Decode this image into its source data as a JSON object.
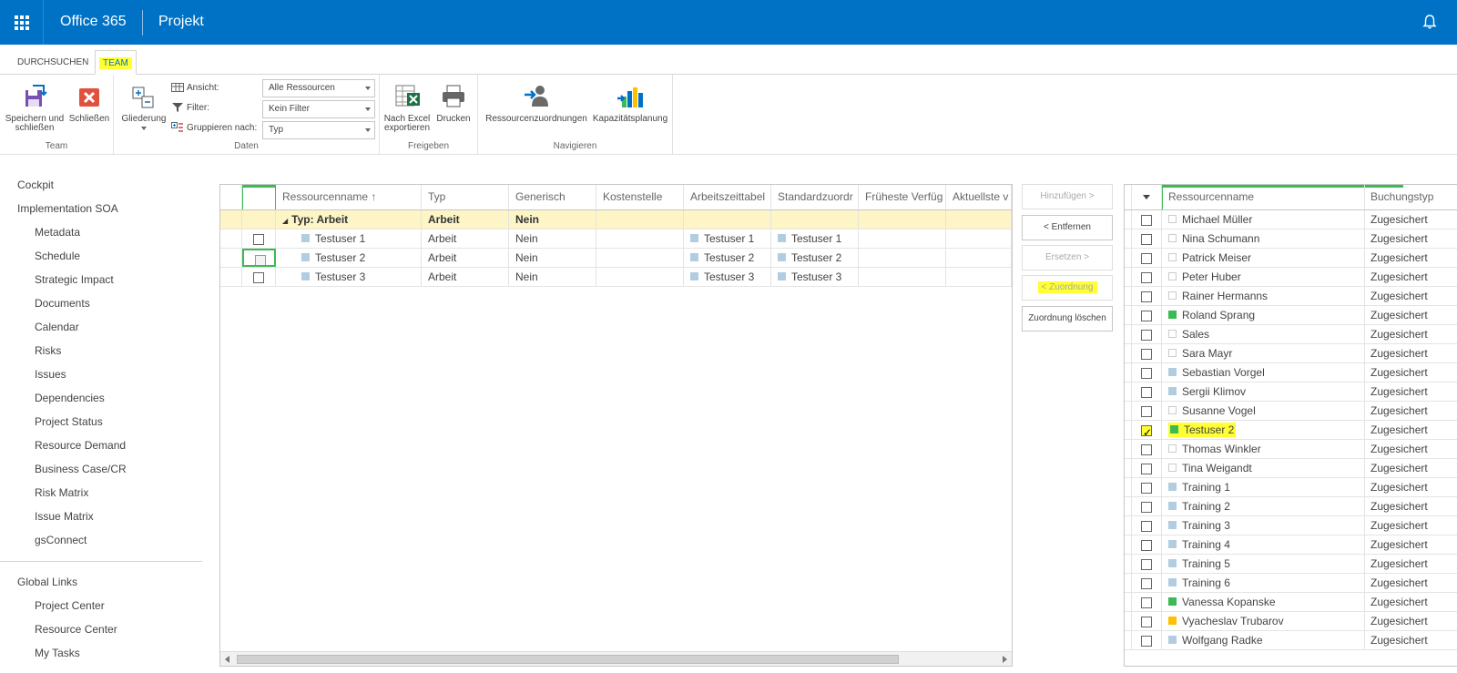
{
  "suitebar": {
    "brand": "Office 365",
    "app": "Projekt"
  },
  "ribbon_tabs": [
    {
      "label": "DURCHSUCHEN"
    },
    {
      "label": "TEAM"
    }
  ],
  "ribbon": {
    "team_group": {
      "label": "Team",
      "save": "Speichern und schließen",
      "close": "Schließen"
    },
    "daten_group": {
      "label": "Daten",
      "outline": "Gliederung",
      "view_label": "Ansicht:",
      "view_value": "Alle Ressourcen",
      "filter_label": "Filter:",
      "filter_value": "Kein Filter",
      "group_label": "Gruppieren nach:",
      "group_value": "Typ"
    },
    "freigeben_group": {
      "label": "Freigeben",
      "export": "Nach Excel exportieren",
      "print": "Drucken"
    },
    "navigieren_group": {
      "label": "Navigieren",
      "assignments": "Ressourcenzuordnungen",
      "capacity": "Kapazitätsplanung"
    }
  },
  "leftnav": {
    "items": [
      "Cockpit",
      "Implementation SOA",
      "Metadata",
      "Schedule",
      "Strategic Impact",
      "Documents",
      "Calendar",
      "Risks",
      "Issues",
      "Dependencies",
      "Project Status",
      "Resource Demand",
      "Business Case/CR",
      "Risk Matrix",
      "Issue Matrix",
      "gsConnect"
    ],
    "global_title": "Global Links",
    "global_items": [
      "Project Center",
      "Resource Center",
      "My Tasks"
    ]
  },
  "maingrid": {
    "headers": [
      "Ressourcenname ↑",
      "Typ",
      "Generisch",
      "Kostenstelle",
      "Arbeitszeittabel",
      "Standardzuordr",
      "Früheste Verfüg",
      "Aktuellste v"
    ],
    "group_row": {
      "name": "Typ: Arbeit",
      "type": "Arbeit",
      "generic": "Nein"
    },
    "rows": [
      {
        "name": "Testuser 1",
        "type": "Arbeit",
        "generic": "Nein",
        "timesheet": "Testuser 1",
        "default": "Testuser 1"
      },
      {
        "name": "Testuser 2",
        "type": "Arbeit",
        "generic": "Nein",
        "timesheet": "Testuser 2",
        "default": "Testuser 2"
      },
      {
        "name": "Testuser 3",
        "type": "Arbeit",
        "generic": "Nein",
        "timesheet": "Testuser 3",
        "default": "Testuser 3"
      }
    ]
  },
  "middle_buttons": {
    "add": "Hinzufügen >",
    "remove": "< Entfernen",
    "replace": "Ersetzen >",
    "assign": "< Zuordnung",
    "clear": "Zuordnung löschen"
  },
  "rightgrid": {
    "headers": [
      "Ressourcenname",
      "Buchungstyp"
    ],
    "rows": [
      {
        "name": "Michael Müller",
        "booking": "Zugesichert",
        "sq": "empty",
        "checked": false
      },
      {
        "name": "Nina Schumann",
        "booking": "Zugesichert",
        "sq": "empty",
        "checked": false
      },
      {
        "name": "Patrick Meiser",
        "booking": "Zugesichert",
        "sq": "empty",
        "checked": false
      },
      {
        "name": "Peter Huber",
        "booking": "Zugesichert",
        "sq": "empty",
        "checked": false
      },
      {
        "name": "Rainer Hermanns",
        "booking": "Zugesichert",
        "sq": "empty",
        "checked": false
      },
      {
        "name": "Roland Sprang",
        "booking": "Zugesichert",
        "sq": "green",
        "checked": false
      },
      {
        "name": "Sales",
        "booking": "Zugesichert",
        "sq": "empty",
        "checked": false
      },
      {
        "name": "Sara Mayr",
        "booking": "Zugesichert",
        "sq": "empty",
        "checked": false
      },
      {
        "name": "Sebastian Vorgel",
        "booking": "Zugesichert",
        "sq": "blue",
        "checked": false
      },
      {
        "name": "Sergii Klimov",
        "booking": "Zugesichert",
        "sq": "blue",
        "checked": false
      },
      {
        "name": "Susanne Vogel",
        "booking": "Zugesichert",
        "sq": "empty",
        "checked": false
      },
      {
        "name": "Testuser 2",
        "booking": "Zugesichert",
        "sq": "green",
        "checked": true
      },
      {
        "name": "Thomas Winkler",
        "booking": "Zugesichert",
        "sq": "empty",
        "checked": false
      },
      {
        "name": "Tina Weigandt",
        "booking": "Zugesichert",
        "sq": "empty",
        "checked": false
      },
      {
        "name": "Training 1",
        "booking": "Zugesichert",
        "sq": "blue",
        "checked": false
      },
      {
        "name": "Training 2",
        "booking": "Zugesichert",
        "sq": "blue",
        "checked": false
      },
      {
        "name": "Training 3",
        "booking": "Zugesichert",
        "sq": "blue",
        "checked": false
      },
      {
        "name": "Training 4",
        "booking": "Zugesichert",
        "sq": "blue",
        "checked": false
      },
      {
        "name": "Training 5",
        "booking": "Zugesichert",
        "sq": "blue",
        "checked": false
      },
      {
        "name": "Training 6",
        "booking": "Zugesichert",
        "sq": "blue",
        "checked": false
      },
      {
        "name": "Vanessa Kopanske",
        "booking": "Zugesichert",
        "sq": "green",
        "checked": false
      },
      {
        "name": "Vyacheslav Trubarov",
        "booking": "Zugesichert",
        "sq": "yellow",
        "checked": false
      },
      {
        "name": "Wolfgang Radke",
        "booking": "Zugesichert",
        "sq": "blue",
        "checked": false
      }
    ]
  },
  "colors": {
    "suitebar": "#0072c6",
    "highlight": "#ffff33",
    "group_row": "#fdf5c6",
    "accent_green": "#3cba54"
  }
}
